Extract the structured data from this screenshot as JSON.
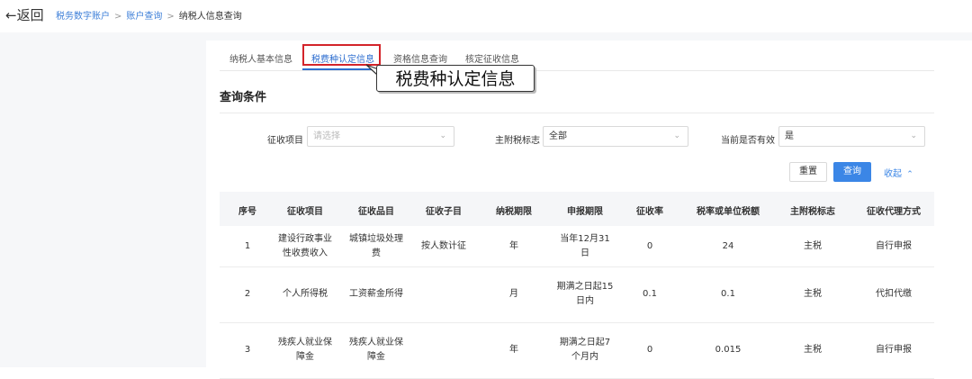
{
  "topbar": {
    "back_label": "←返回",
    "breadcrumbs": [
      "税务数字账户",
      "账户查询",
      "纳税人信息查询"
    ],
    "separator": ">"
  },
  "tabs": [
    {
      "label": "纳税人基本信息",
      "active": false
    },
    {
      "label": "税费种认定信息",
      "active": true
    },
    {
      "label": "资格信息查询",
      "active": false
    },
    {
      "label": "核定征收信息",
      "active": false
    }
  ],
  "callout_text": "税费种认定信息",
  "section_title": "查询条件",
  "filters": [
    {
      "label": "征收项目",
      "value": "",
      "placeholder": "请选择"
    },
    {
      "label": "主附税标志",
      "value": "全部",
      "placeholder": ""
    },
    {
      "label": "当前是否有效",
      "value": "是",
      "placeholder": ""
    }
  ],
  "buttons": {
    "reset": "重置",
    "query": "查询",
    "collapse": "收起"
  },
  "table": {
    "headers": [
      "序号",
      "征收项目",
      "征收品目",
      "征收子目",
      "纳税期限",
      "申报期限",
      "征收率",
      "税率或单位税额",
      "主附税标志",
      "征收代理方式"
    ],
    "rows": [
      [
        "1",
        "建设行政事业性收费收入",
        "城镇垃圾处理费",
        "按人数计征",
        "年",
        "当年12月31日",
        "0",
        "24",
        "主税",
        "自行申报"
      ],
      [
        "2",
        "个人所得税",
        "工资薪金所得",
        "",
        "月",
        "期满之日起15日内",
        "0.1",
        "0.1",
        "主税",
        "代扣代缴"
      ],
      [
        "3",
        "残疾人就业保障金",
        "残疾人就业保障金",
        "",
        "年",
        "期满之日起7个月内",
        "0",
        "0.015",
        "主税",
        "自行申报"
      ]
    ]
  },
  "colors": {
    "accent": "#3b86e6",
    "highlight_box": "#d3242a"
  }
}
